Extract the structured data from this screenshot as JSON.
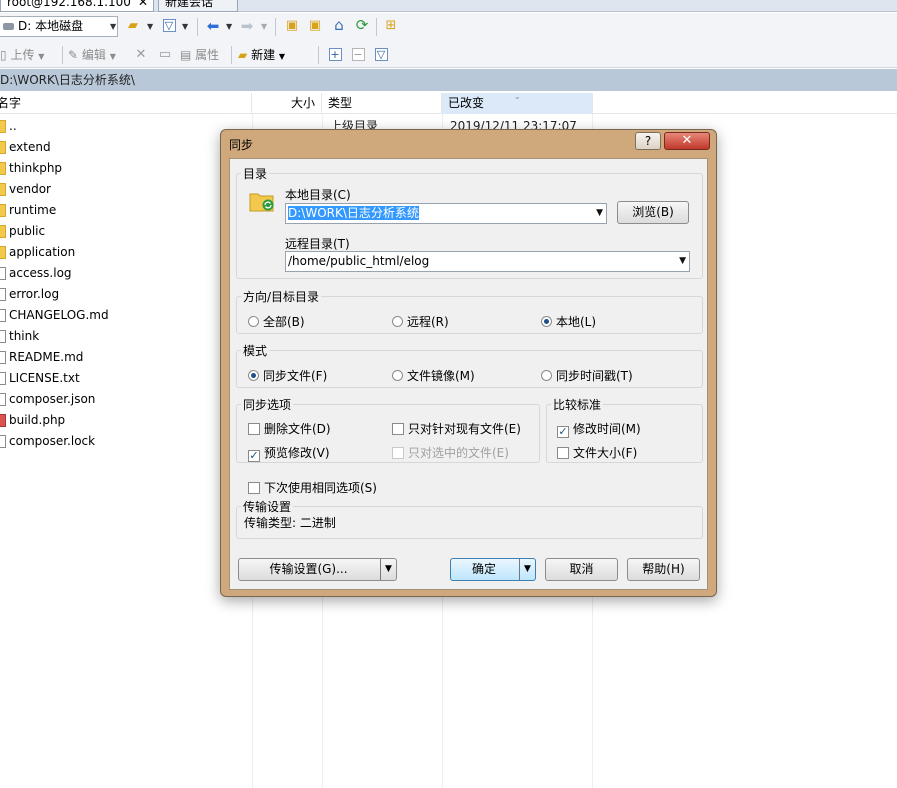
{
  "tabs": [
    {
      "label": "root@192.168.1.100",
      "close": "✕"
    },
    {
      "label": "新建会话"
    }
  ],
  "drive": {
    "value": "D: 本地磁盘"
  },
  "toolbar2": {
    "upload": "上传",
    "edit": "编辑",
    "properties": "属性",
    "new": "新建"
  },
  "path": "D:\\WORK\\日志分析系统\\",
  "columns": {
    "name": "名字",
    "size": "大小",
    "type": "类型",
    "modified": "已改变"
  },
  "files": [
    {
      "name": "..",
      "kind": "folder"
    },
    {
      "name": "extend",
      "kind": "folder"
    },
    {
      "name": "thinkphp",
      "kind": "folder"
    },
    {
      "name": "vendor",
      "kind": "folder"
    },
    {
      "name": "runtime",
      "kind": "folder"
    },
    {
      "name": "public",
      "kind": "folder"
    },
    {
      "name": "application",
      "kind": "folder"
    },
    {
      "name": "access.log",
      "kind": "file"
    },
    {
      "name": "error.log",
      "kind": "file"
    },
    {
      "name": "CHANGELOG.md",
      "kind": "file"
    },
    {
      "name": "think",
      "kind": "file"
    },
    {
      "name": "README.md",
      "kind": "file"
    },
    {
      "name": "LICENSE.txt",
      "kind": "file"
    },
    {
      "name": "composer.json",
      "kind": "file"
    },
    {
      "name": "build.php",
      "kind": "php"
    },
    {
      "name": "composer.lock",
      "kind": "file"
    }
  ],
  "behind_row": {
    "type": "上级目录",
    "modified": "2019/12/11  23:17:07"
  },
  "dialog": {
    "title": "同步",
    "help_btn": "?",
    "close_btn": "✕",
    "dir_group": "目录",
    "local_dir_label": "本地目录(C)",
    "local_dir_value": "D:\\WORK\\日志分析系统",
    "browse_btn": "浏览(B)",
    "remote_dir_label": "远程目录(T)",
    "remote_dir_value": "/home/public_html/elog",
    "direction_group": "方向/目标目录",
    "direction": [
      {
        "label": "全部(B)",
        "checked": false
      },
      {
        "label": "远程(R)",
        "checked": false
      },
      {
        "label": "本地(L)",
        "checked": true
      }
    ],
    "mode_group": "模式",
    "mode": [
      {
        "label": "同步文件(F)",
        "checked": true
      },
      {
        "label": "文件镜像(M)",
        "checked": false
      },
      {
        "label": "同步时间戳(T)",
        "checked": false
      }
    ],
    "sync_options_group": "同步选项",
    "sync_options": [
      {
        "label": "删除文件(D)",
        "checked": false,
        "disabled": false
      },
      {
        "label": "只对针对现有文件(E)",
        "checked": false,
        "disabled": false
      },
      {
        "label": "预览修改(V)",
        "checked": true,
        "disabled": false
      },
      {
        "label": "只对选中的文件(E)",
        "checked": false,
        "disabled": true
      }
    ],
    "compare_group": "比较标准",
    "compare": [
      {
        "label": "修改时间(M)",
        "checked": true
      },
      {
        "label": "文件大小(F)",
        "checked": false
      }
    ],
    "same_options_label": "下次使用相同选项(S)",
    "transfer_group": "传输设置",
    "transfer_type": "传输类型: 二进制",
    "transfer_settings_btn": "传输设置(G)...",
    "ok_btn": "确定",
    "cancel_btn": "取消",
    "help_footer_btn": "帮助(H)"
  },
  "colors": {
    "dialog_frame": "#cfa97c",
    "pathbar": "#b9c8d8",
    "selection": "#3399ff"
  }
}
